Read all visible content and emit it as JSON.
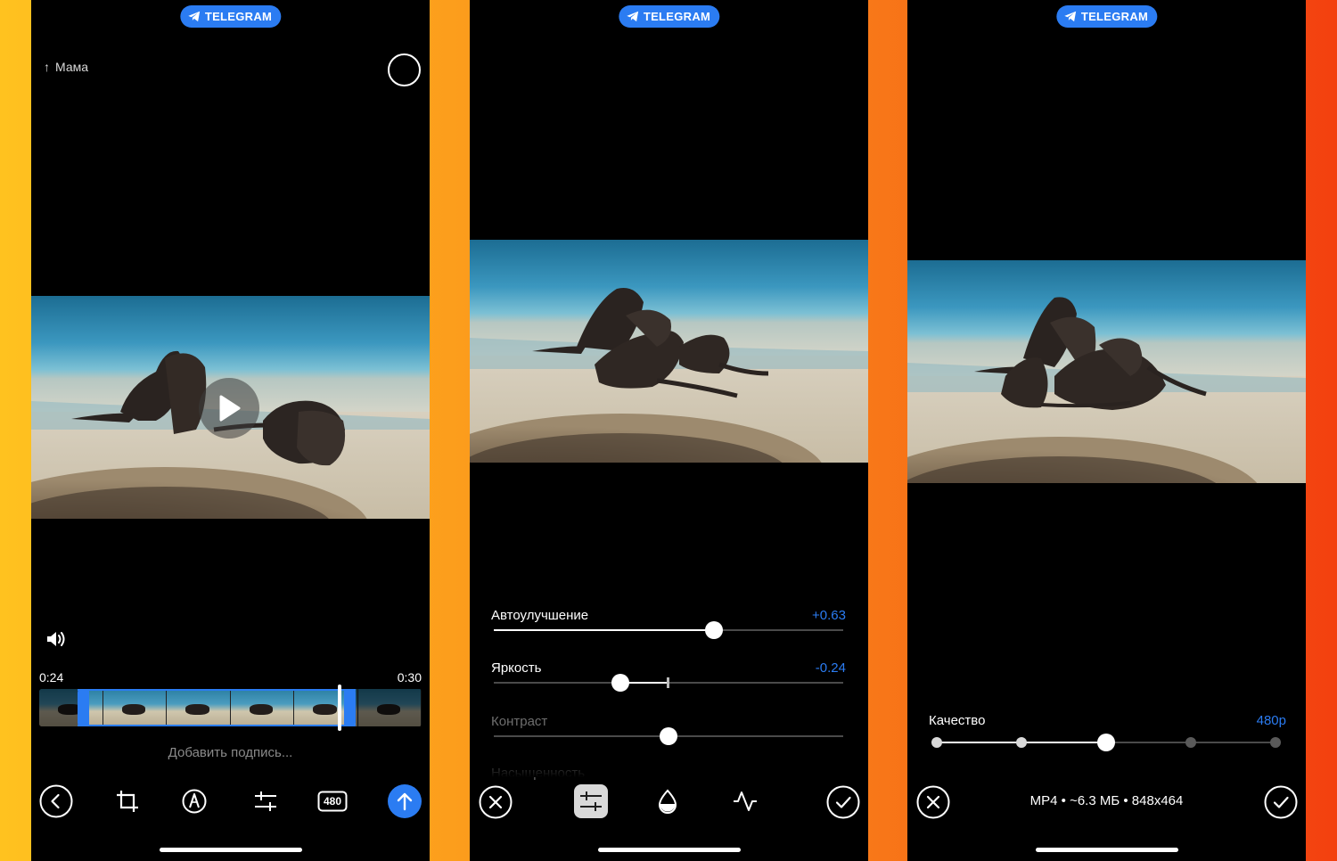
{
  "badge": {
    "label": "TELEGRAM"
  },
  "phone1": {
    "recipient": "Мама",
    "time_start": "0:24",
    "time_end": "0:30",
    "caption_placeholder": "Добавить подпись...",
    "quality_badge": "480",
    "toolbar_icons": [
      "back-icon",
      "crop-icon",
      "draw-icon",
      "adjust-icon",
      "quality-icon",
      "send-icon"
    ]
  },
  "phone2": {
    "sliders": [
      {
        "label": "Автоулучшение",
        "value": "+0.63"
      },
      {
        "label": "Яркость",
        "value": "-0.24"
      },
      {
        "label": "Контраст",
        "value": ""
      },
      {
        "label": "Насыщенность",
        "value": ""
      }
    ],
    "toolbar_icons": [
      "cancel-icon",
      "adjust-tools-icon",
      "tint-icon",
      "curves-icon",
      "confirm-icon"
    ]
  },
  "phone3": {
    "quality_label": "Качество",
    "quality_value": "480p",
    "quality_levels": 5,
    "quality_selected_index": 2,
    "file_info": "MP4 • ~6.3 МБ • 848x464",
    "toolbar_icons": [
      "cancel-icon",
      "confirm-icon"
    ]
  },
  "colors": {
    "accent": "#2b7cf2",
    "background": "#000000"
  }
}
